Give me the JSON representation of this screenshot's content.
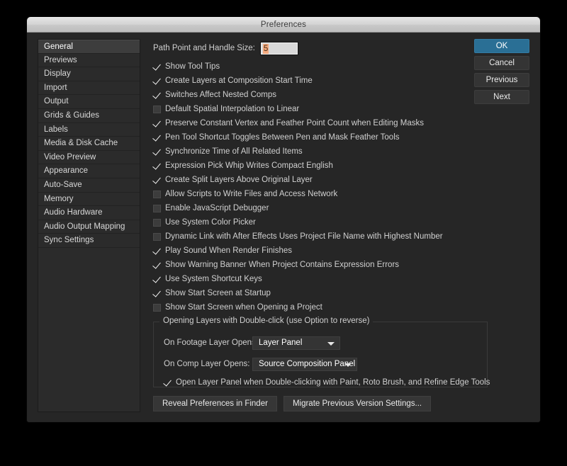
{
  "window": {
    "title": "Preferences"
  },
  "sidebar": {
    "items": [
      {
        "label": "General",
        "selected": true
      },
      {
        "label": "Previews",
        "selected": false
      },
      {
        "label": "Display",
        "selected": false
      },
      {
        "label": "Import",
        "selected": false
      },
      {
        "label": "Output",
        "selected": false
      },
      {
        "label": "Grids & Guides",
        "selected": false
      },
      {
        "label": "Labels",
        "selected": false
      },
      {
        "label": "Media & Disk Cache",
        "selected": false
      },
      {
        "label": "Video Preview",
        "selected": false
      },
      {
        "label": "Appearance",
        "selected": false
      },
      {
        "label": "Auto-Save",
        "selected": false
      },
      {
        "label": "Memory",
        "selected": false
      },
      {
        "label": "Audio Hardware",
        "selected": false
      },
      {
        "label": "Audio Output Mapping",
        "selected": false
      },
      {
        "label": "Sync Settings",
        "selected": false
      }
    ]
  },
  "main": {
    "path_point": {
      "label": "Path Point and Handle Size:",
      "value": "5"
    },
    "checkboxes": [
      {
        "label": "Show Tool Tips",
        "checked": true
      },
      {
        "label": "Create Layers at Composition Start Time",
        "checked": true
      },
      {
        "label": "Switches Affect Nested Comps",
        "checked": true
      },
      {
        "label": "Default Spatial Interpolation to Linear",
        "checked": false
      },
      {
        "label": "Preserve Constant Vertex and Feather Point Count when Editing Masks",
        "checked": true
      },
      {
        "label": "Pen Tool Shortcut Toggles Between Pen and Mask Feather Tools",
        "checked": true
      },
      {
        "label": "Synchronize Time of All Related Items",
        "checked": true
      },
      {
        "label": "Expression Pick Whip Writes Compact English",
        "checked": true
      },
      {
        "label": "Create Split Layers Above Original Layer",
        "checked": true
      },
      {
        "label": "Allow Scripts to Write Files and Access Network",
        "checked": false
      },
      {
        "label": "Enable JavaScript Debugger",
        "checked": false
      },
      {
        "label": "Use System Color Picker",
        "checked": false
      },
      {
        "label": "Dynamic Link with After Effects Uses Project File Name with Highest Number",
        "checked": false
      },
      {
        "label": "Play Sound When Render Finishes",
        "checked": true
      },
      {
        "label": "Show Warning Banner When Project Contains Expression Errors",
        "checked": true
      },
      {
        "label": "Use System Shortcut Keys",
        "checked": true
      },
      {
        "label": "Show Start Screen at Startup",
        "checked": true
      },
      {
        "label": "Show Start Screen when Opening a Project",
        "checked": false
      }
    ],
    "group": {
      "label": "Opening Layers with Double-click (use Option to reverse)",
      "footage_label": "On Footage Layer Opens:",
      "footage_value": "Layer Panel",
      "comp_label": "On Comp Layer Opens:",
      "comp_value": "Source Composition Panel",
      "open_layer_checkbox": {
        "label": "Open Layer Panel when Double-clicking with Paint, Roto Brush, and Refine Edge Tools",
        "checked": true
      }
    },
    "bottom_buttons": [
      {
        "label": "Reveal Preferences in Finder"
      },
      {
        "label": "Migrate Previous Version Settings..."
      }
    ]
  },
  "right_buttons": [
    {
      "label": "OK",
      "primary": true
    },
    {
      "label": "Cancel",
      "primary": false
    },
    {
      "label": "Previous",
      "primary": false
    },
    {
      "label": "Next",
      "primary": false
    }
  ],
  "colors": {
    "accent": "#2a6f95",
    "panel_bg": "#262626",
    "sidebar_bg": "#2b2b2b",
    "selection_highlight": "#f5ab80",
    "text": "#d0d0d0"
  }
}
